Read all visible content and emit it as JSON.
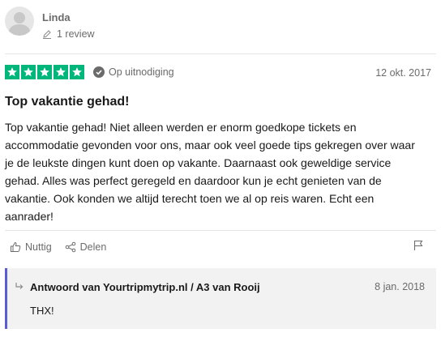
{
  "author": {
    "name": "Linda",
    "review_count": "1 review",
    "avatar_icon": "user-silhouette-icon",
    "count_icon": "pen-icon"
  },
  "review": {
    "rating": 5,
    "rating_max": 5,
    "star_color": "#00b67a",
    "verified_label": "Op uitnodiging",
    "verified_icon": "check-circle-icon",
    "date": "12 okt. 2017",
    "title": "Top vakantie gehad!",
    "body": "Top vakantie gehad! Niet alleen werden er enorm goedkope tickets en accommodatie gevonden voor ons, maar ook veel goede tips gekregen over waar je de leukste dingen kunt doen op vakante. Daarnaast ook geweldige service gehad. Alles was perfect geregeld en daardoor kun je echt genieten van de vakantie. Ook konden we altijd terecht toen we al op reis waren. Echt een aanrader!"
  },
  "actions": {
    "useful_label": "Nuttig",
    "useful_icon": "thumbs-up-icon",
    "share_label": "Delen",
    "share_icon": "share-icon",
    "report_icon": "flag-icon"
  },
  "reply": {
    "title": "Antwoord van Yourtripmytrip.nl / A3 van Rooij",
    "date": "8 jan. 2018",
    "body": "THX!",
    "accent_color": "#5a5bd5",
    "arrow_icon": "reply-arrow-icon"
  }
}
